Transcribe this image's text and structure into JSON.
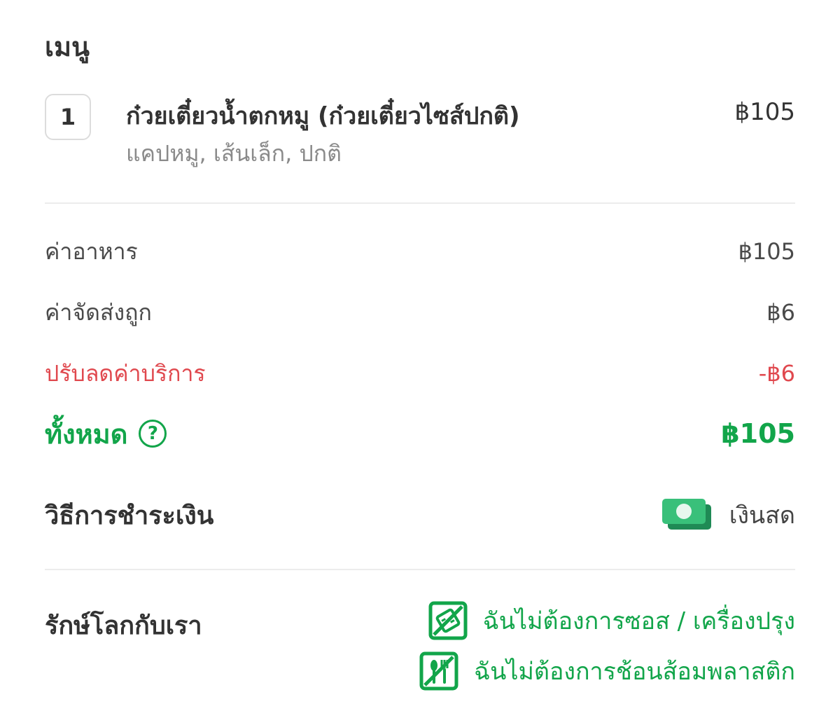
{
  "menu": {
    "title": "เมนู",
    "items": [
      {
        "qty": "1",
        "name": "ก๋วยเตี๋ยวน้ำตกหมู (ก๋วยเตี๋ยวไซส์ปกติ)",
        "options": "แคปหมู, เส้นเล็ก, ปกติ",
        "price": "฿105"
      }
    ]
  },
  "summary": {
    "food_label": "ค่าอาหาร",
    "food_value": "฿105",
    "delivery_label": "ค่าจัดส่งถูก",
    "delivery_value": "฿6",
    "discount_label": "ปรับลดค่าบริการ",
    "discount_value": "-฿6",
    "total_label": "ทั้งหมด",
    "total_value": "฿105",
    "help_symbol": "?"
  },
  "payment": {
    "label": "วิธีการชำระเงิน",
    "method_icon": "cash-icon",
    "method": "เงินสด"
  },
  "eco": {
    "label": "รักษ์โลกกับเรา",
    "options": [
      {
        "icon": "no-sauce-icon",
        "text": "ฉันไม่ต้องการซอส / เครื่องปรุง"
      },
      {
        "icon": "no-cutlery-icon",
        "text": "ฉันไม่ต้องการช้อนส้อมพลาสติก"
      }
    ]
  },
  "colors": {
    "accent_green": "#12a54a",
    "discount_red": "#e0484e",
    "muted_text": "#8a8a8a",
    "divider": "#ececec"
  }
}
